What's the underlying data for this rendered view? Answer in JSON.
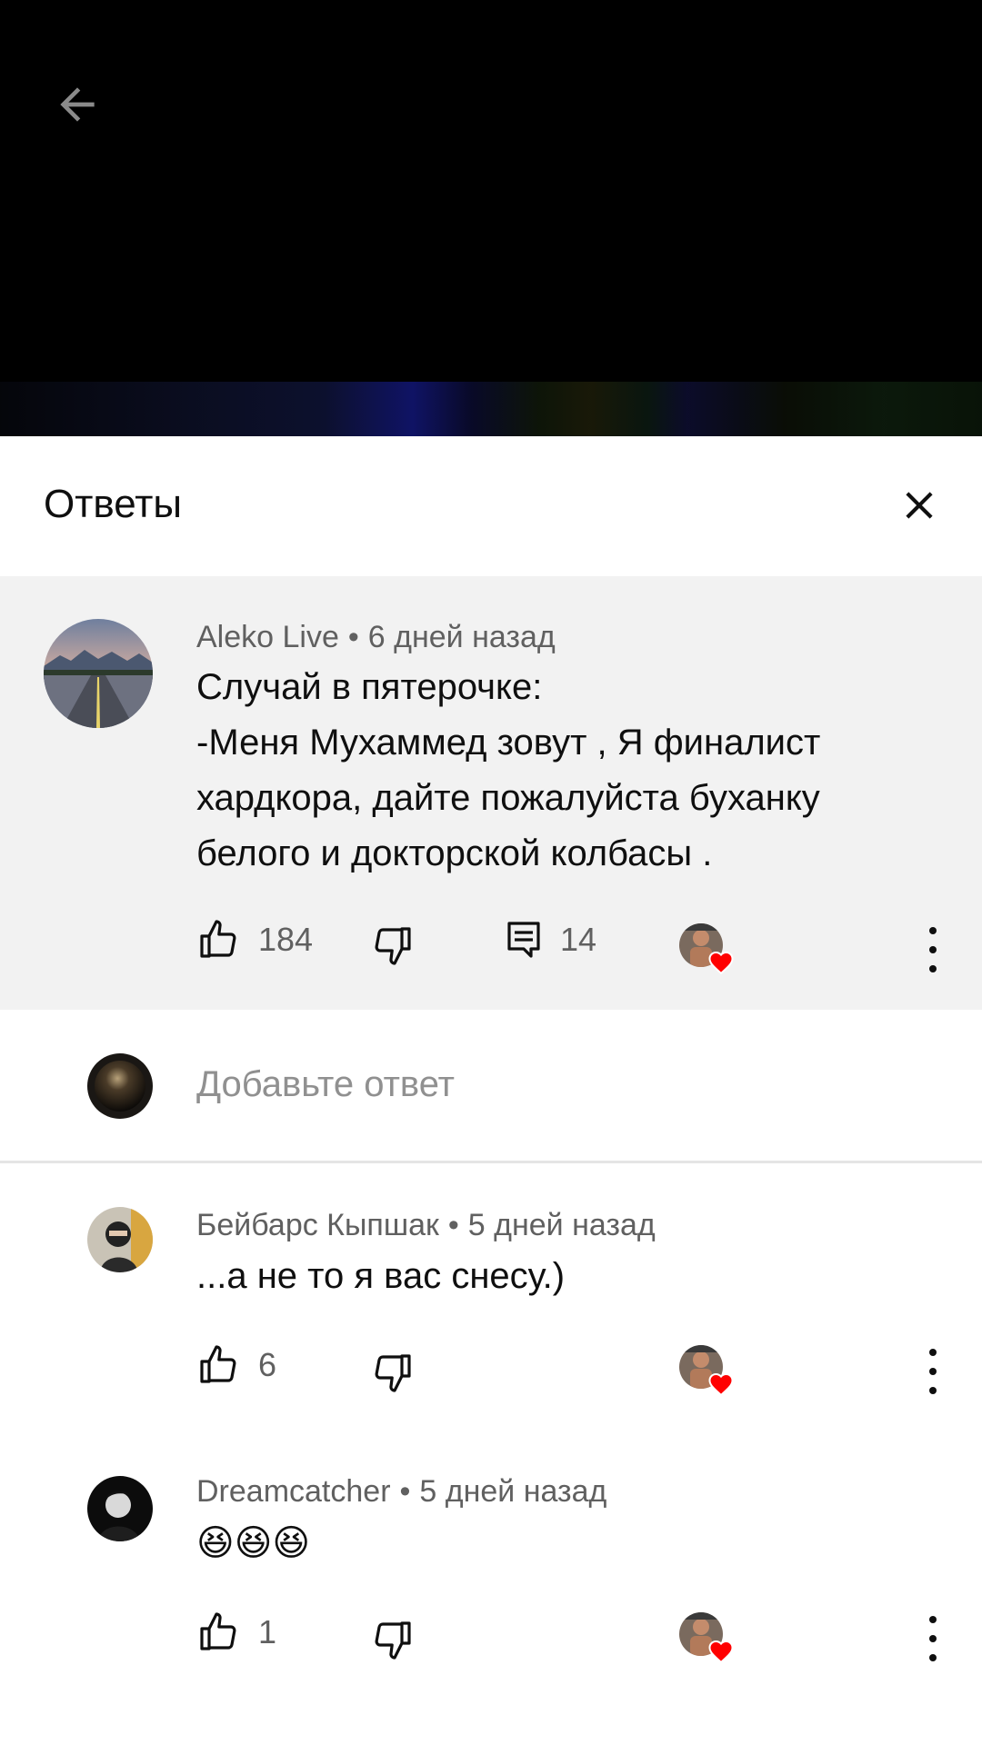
{
  "header": {
    "title": "Ответы"
  },
  "parent_comment": {
    "author": "Aleko Live",
    "time": "6 дней назад",
    "text": "Случай в пятерочке:\n-Меня Мухаммед зовут , Я финалист хардкора, дайте пожалуйста буханку белого  и докторской колбасы .",
    "likes": "184",
    "replies": "14"
  },
  "reply_box": {
    "placeholder": "Добавьте ответ"
  },
  "replies": [
    {
      "author": "Бейбарс Кыпшак",
      "time": "5 дней назад",
      "text": "...а не то я вас снесу.)",
      "likes": "6"
    },
    {
      "author": "Dreamcatcher",
      "time": "5 дней назад",
      "text": "😆😆😆",
      "likes": "1"
    }
  ],
  "colors": {
    "heart": "#ff0000",
    "meta": "#606060",
    "highlight_bg": "#f2f2f2"
  },
  "icons": [
    "back-arrow-icon",
    "close-icon",
    "thumbs-up-icon",
    "thumbs-down-icon",
    "reply-icon",
    "heart-icon",
    "more-vert-icon"
  ]
}
